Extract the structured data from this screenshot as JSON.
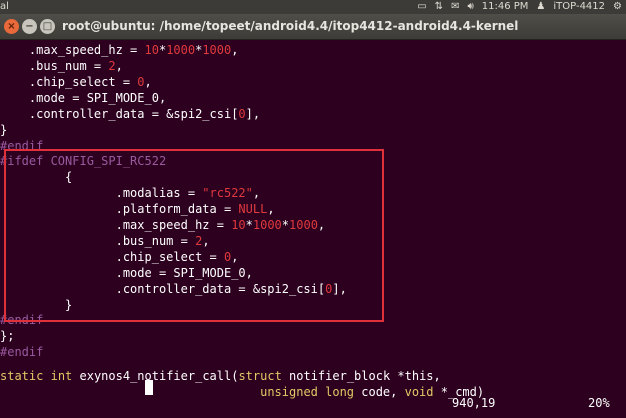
{
  "top_panel": {
    "app_label": "al",
    "time": "11:46 PM",
    "user": "iTOP-4412"
  },
  "window": {
    "title": "root@ubuntu: /home/topeet/android4.4/itop4412-android4.4-kernel",
    "close_glyph": "×",
    "min_glyph": "−",
    "max_glyph": "□"
  },
  "code": {
    "l1": [
      ".max_speed_hz = ",
      "10",
      "*",
      "1000",
      "*",
      "1000",
      ","
    ],
    "l2": [
      ".bus_num = ",
      "2",
      ","
    ],
    "l3": [
      ".chip_select = ",
      "0",
      ","
    ],
    "l4": ".mode = SPI_MODE_0,",
    "l5": [
      ".controller_data = &spi2_csi[",
      "0",
      "],"
    ],
    "l6": "}",
    "l7": "#endif",
    "l8": "#ifdef CONFIG_SPI_RC522",
    "l9": "{",
    "l10": [
      ".modalias = ",
      "\"rc522\"",
      ","
    ],
    "l11": [
      ".platform_data = ",
      "NULL",
      ","
    ],
    "l12": [
      ".max_speed_hz = ",
      "10",
      "*",
      "1000",
      "*",
      "1000",
      ","
    ],
    "l13": [
      ".bus_num = ",
      "2",
      ","
    ],
    "l14": [
      ".chip_select = ",
      "0",
      ","
    ],
    "l15": ".mode = SPI_MODE_0,",
    "l16": [
      ".controller_data = &spi2_csi[",
      "0",
      "],"
    ],
    "l17": "}",
    "l18": "#endif",
    "l19": "};",
    "l20": "#endif",
    "l21": [
      "static",
      " ",
      "int",
      " exynos4_notifier_call(",
      "struct",
      " notifier_block *this,"
    ],
    "l22": [
      "unsigned",
      " ",
      "long",
      " code, ",
      "void",
      " *_cmd)"
    ]
  },
  "status": {
    "position": "940,19",
    "percent": "20%"
  },
  "colors": {
    "background": "#2c001e",
    "number": "#e0393e",
    "preprocessor": "#9a5aa0",
    "keyword": "#e4c866",
    "highlight_box": "#e0303a"
  }
}
